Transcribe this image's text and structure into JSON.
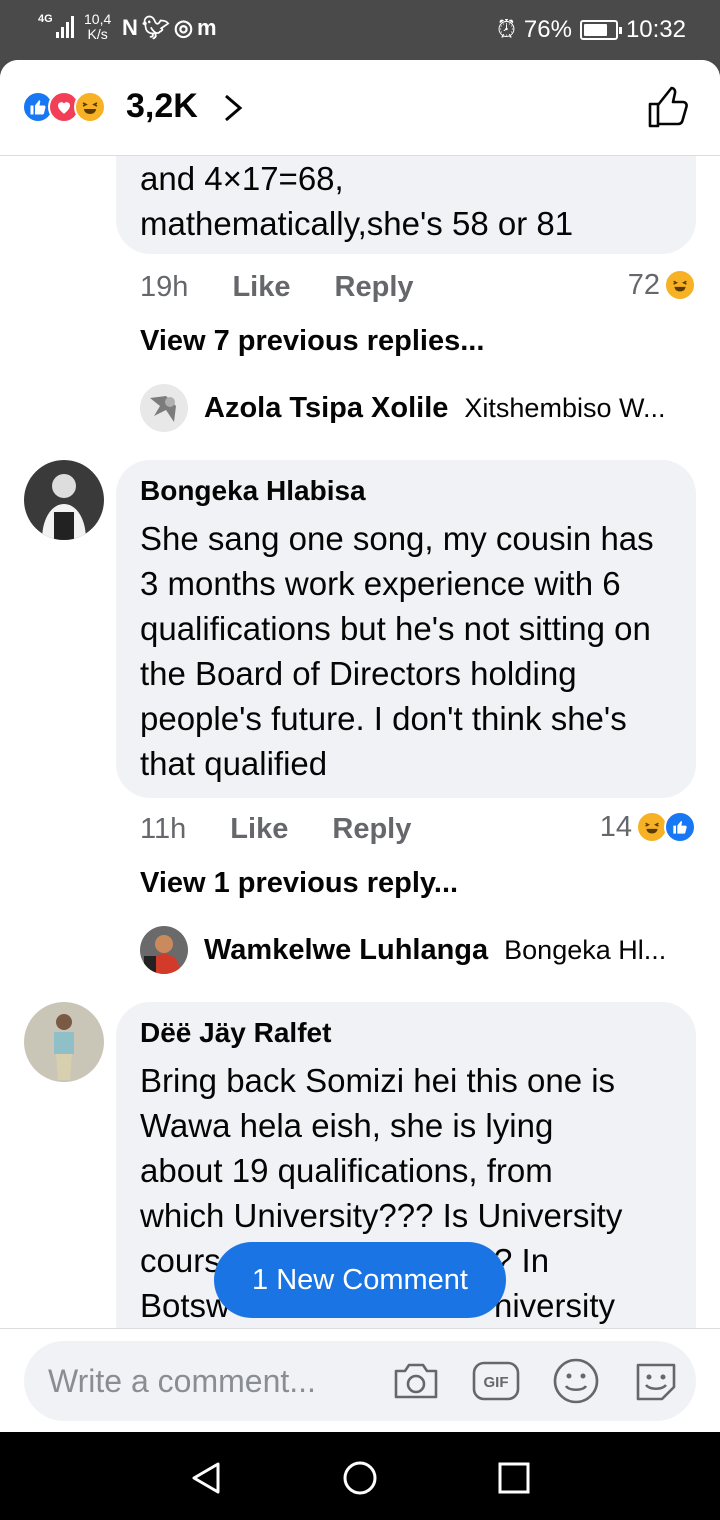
{
  "status_bar": {
    "network": "4G",
    "speed_value": "10,4",
    "speed_unit": "K/s",
    "battery": "76%",
    "battery_level": 0.76,
    "time": "10:32"
  },
  "header": {
    "reaction_count": "3,2K"
  },
  "comments": [
    {
      "partial_text": "and 4×17=68,\nmathematically,she's 58 or 81",
      "time": "19h",
      "like_label": "Like",
      "reply_label": "Reply",
      "reaction_count": "72",
      "view_replies": "View 7 previous replies...",
      "reply_preview": {
        "name": "Azola Tsipa Xolile",
        "text": "Xitshembiso W..."
      }
    },
    {
      "author": "Bongeka Hlabisa",
      "text": "She sang one song, my cousin has 3 months work experience with 6 qualifications but he's not sitting on the Board of Directors holding people's future. I don't think she's that qualified",
      "time": "11h",
      "like_label": "Like",
      "reply_label": "Reply",
      "reaction_count": "14",
      "view_replies": "View 1 previous reply...",
      "reply_preview": {
        "name": "Wamkelwe Luhlanga",
        "text": "Bongeka Hl..."
      }
    },
    {
      "author": "Dëë Jäy Ralfet",
      "text_lines": [
        "Bring back Somizi hei this one is",
        "Wawa hela eish, she is lying",
        "about 19 qualifications, from",
        "which University??? Is University",
        "cours",
        "? In",
        "Botsw",
        "niversity"
      ]
    }
  ],
  "new_comment_label": "1 New Comment",
  "composer": {
    "placeholder": "Write a comment..."
  }
}
